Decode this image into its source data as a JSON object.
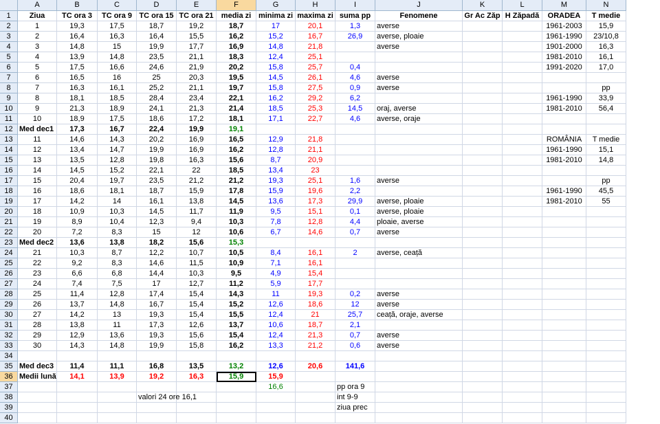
{
  "columns": [
    "A",
    "B",
    "C",
    "D",
    "E",
    "F",
    "G",
    "H",
    "I",
    "J",
    "K",
    "L",
    "M",
    "N"
  ],
  "selected_column": "F",
  "selected_row": "36",
  "header_row": [
    "Ziua",
    "TC ora 3",
    "TC ora 9",
    "TC ora 15",
    "TC ora 21",
    "media zi",
    "minima zi",
    "maxima zi",
    "suma pp",
    "Fenomene",
    "Gr Ac Zăp",
    "H Zăpadă",
    "ORADEA",
    "T medie"
  ],
  "rows": [
    {
      "r": "2",
      "v": [
        "1",
        "19,3",
        "17,5",
        "18,7",
        "19,2",
        "18,7",
        "17",
        "20,1",
        "1,3",
        "averse",
        "",
        "",
        "1961-2003",
        "15,9"
      ]
    },
    {
      "r": "3",
      "v": [
        "2",
        "16,4",
        "16,3",
        "16,4",
        "15,5",
        "16,2",
        "15,2",
        "16,7",
        "26,9",
        "averse, ploaie",
        "",
        "",
        "1961-1990",
        "23/10,8"
      ]
    },
    {
      "r": "4",
      "v": [
        "3",
        "14,8",
        "15",
        "19,9",
        "17,7",
        "16,9",
        "14,8",
        "21,8",
        "",
        "averse",
        "",
        "",
        "1901-2000",
        "16,3"
      ]
    },
    {
      "r": "5",
      "v": [
        "4",
        "13,9",
        "14,8",
        "23,5",
        "21,1",
        "18,3",
        "12,4",
        "25,1",
        "",
        "",
        "",
        "",
        "1981-2010",
        "16,1"
      ]
    },
    {
      "r": "6",
      "v": [
        "5",
        "17,5",
        "16,6",
        "24,6",
        "21,9",
        "20,2",
        "15,8",
        "25,7",
        "0,4",
        "",
        "",
        "",
        "1991-2020",
        "17,0"
      ]
    },
    {
      "r": "7",
      "v": [
        "6",
        "16,5",
        "16",
        "25",
        "20,3",
        "19,5",
        "14,5",
        "26,1",
        "4,6",
        "averse",
        "",
        "",
        "",
        ""
      ]
    },
    {
      "r": "8",
      "v": [
        "7",
        "16,3",
        "16,1",
        "25,2",
        "21,1",
        "19,7",
        "15,8",
        "27,5",
        "0,9",
        "averse",
        "",
        "",
        "",
        "pp"
      ]
    },
    {
      "r": "9",
      "v": [
        "8",
        "18,1",
        "18,5",
        "28,4",
        "23,4",
        "22,1",
        "16,2",
        "29,2",
        "6,2",
        "",
        "",
        "",
        "1961-1990",
        "33,9"
      ]
    },
    {
      "r": "10",
      "v": [
        "9",
        "21,3",
        "18,9",
        "24,1",
        "21,3",
        "21,4",
        "18,5",
        "25,3",
        "14,5",
        "oraj, averse",
        "",
        "",
        "1981-2010",
        "56,4"
      ]
    },
    {
      "r": "11",
      "v": [
        "10",
        "18,9",
        "17,5",
        "18,6",
        "17,2",
        "18,1",
        "17,1",
        "22,7",
        "4,6",
        "averse, oraje",
        "",
        "",
        "",
        ""
      ]
    },
    {
      "r": "12",
      "v": [
        "Med dec1",
        "17,3",
        "16,7",
        "22,4",
        "19,9",
        "19,1",
        "",
        "",
        "",
        "",
        "",
        "",
        "",
        ""
      ]
    },
    {
      "r": "13",
      "v": [
        "11",
        "14,6",
        "14,3",
        "20,2",
        "16,9",
        "16,5",
        "12,9",
        "21,8",
        "",
        "",
        "",
        "",
        "ROMÂNIA",
        "T medie"
      ]
    },
    {
      "r": "14",
      "v": [
        "12",
        "13,4",
        "14,7",
        "19,9",
        "16,9",
        "16,2",
        "12,8",
        "21,1",
        "",
        "",
        "",
        "",
        "1961-1990",
        "15,1"
      ]
    },
    {
      "r": "15",
      "v": [
        "13",
        "13,5",
        "12,8",
        "19,8",
        "16,3",
        "15,6",
        "8,7",
        "20,9",
        "",
        "",
        "",
        "",
        "1981-2010",
        "14,8"
      ]
    },
    {
      "r": "16",
      "v": [
        "14",
        "14,5",
        "15,2",
        "22,1",
        "22",
        "18,5",
        "13,4",
        "23",
        "",
        "",
        "",
        "",
        "",
        ""
      ]
    },
    {
      "r": "17",
      "v": [
        "15",
        "20,4",
        "19,7",
        "23,5",
        "21,2",
        "21,2",
        "19,3",
        "25,1",
        "1,6",
        "averse",
        "",
        "",
        "",
        "pp"
      ]
    },
    {
      "r": "18",
      "v": [
        "16",
        "18,6",
        "18,1",
        "18,7",
        "15,9",
        "17,8",
        "15,9",
        "19,6",
        "2,2",
        "",
        "",
        "",
        "1961-1990",
        "45,5"
      ]
    },
    {
      "r": "19",
      "v": [
        "17",
        "14,2",
        "14",
        "16,1",
        "13,8",
        "14,5",
        "13,6",
        "17,3",
        "29,9",
        "averse, ploaie",
        "",
        "",
        "1981-2010",
        "55"
      ]
    },
    {
      "r": "20",
      "v": [
        "18",
        "10,9",
        "10,3",
        "14,5",
        "11,7",
        "11,9",
        "9,5",
        "15,1",
        "0,1",
        "averse, ploaie",
        "",
        "",
        "",
        ""
      ]
    },
    {
      "r": "21",
      "v": [
        "19",
        "8,9",
        "10,4",
        "12,3",
        "9,4",
        "10,3",
        "7,8",
        "12,8",
        "4,4",
        "ploaie, averse",
        "",
        "",
        "",
        ""
      ]
    },
    {
      "r": "22",
      "v": [
        "20",
        "7,2",
        "8,3",
        "15",
        "12",
        "10,6",
        "6,7",
        "14,6",
        "0,7",
        "averse",
        "",
        "",
        "",
        ""
      ]
    },
    {
      "r": "23",
      "v": [
        "Med dec2",
        "13,6",
        "13,8",
        "18,2",
        "15,6",
        "15,3",
        "",
        "",
        "",
        "",
        "",
        "",
        "",
        ""
      ]
    },
    {
      "r": "24",
      "v": [
        "21",
        "10,3",
        "8,7",
        "12,2",
        "10,7",
        "10,5",
        "8,4",
        "16,1",
        "2",
        "averse, ceață",
        "",
        "",
        "",
        ""
      ]
    },
    {
      "r": "25",
      "v": [
        "22",
        "9,2",
        "8,3",
        "14,6",
        "11,5",
        "10,9",
        "7,1",
        "16,1",
        "",
        "",
        "",
        "",
        "",
        ""
      ]
    },
    {
      "r": "26",
      "v": [
        "23",
        "6,6",
        "6,8",
        "14,4",
        "10,3",
        "9,5",
        "4,9",
        "15,4",
        "",
        "",
        "",
        "",
        "",
        ""
      ]
    },
    {
      "r": "27",
      "v": [
        "24",
        "7,4",
        "7,5",
        "17",
        "12,7",
        "11,2",
        "5,9",
        "17,7",
        "",
        "",
        "",
        "",
        "",
        ""
      ]
    },
    {
      "r": "28",
      "v": [
        "25",
        "11,4",
        "12,8",
        "17,4",
        "15,4",
        "14,3",
        "11",
        "19,3",
        "0,2",
        "averse",
        "",
        "",
        "",
        ""
      ]
    },
    {
      "r": "29",
      "v": [
        "26",
        "13,7",
        "14,8",
        "16,7",
        "15,4",
        "15,2",
        "12,6",
        "18,6",
        "12",
        "averse",
        "",
        "",
        "",
        ""
      ]
    },
    {
      "r": "30",
      "v": [
        "27",
        "14,2",
        "13",
        "19,3",
        "15,4",
        "15,5",
        "12,4",
        "21",
        "25,7",
        "ceață, oraje, averse",
        "",
        "",
        "",
        ""
      ]
    },
    {
      "r": "31",
      "v": [
        "28",
        "13,8",
        "11",
        "17,3",
        "12,6",
        "13,7",
        "10,6",
        "18,7",
        "2,1",
        "",
        "",
        "",
        "",
        ""
      ]
    },
    {
      "r": "32",
      "v": [
        "29",
        "12,9",
        "13,6",
        "19,3",
        "15,6",
        "15,4",
        "12,4",
        "21,3",
        "0,7",
        "averse",
        "",
        "",
        "",
        ""
      ]
    },
    {
      "r": "33",
      "v": [
        "30",
        "14,3",
        "14,8",
        "19,9",
        "15,8",
        "16,2",
        "13,3",
        "21,2",
        "0,6",
        "averse",
        "",
        "",
        "",
        ""
      ]
    },
    {
      "r": "34",
      "v": [
        "",
        "",
        "",
        "",
        "",
        "",
        "",
        "",
        "",
        "",
        "",
        "",
        "",
        ""
      ]
    },
    {
      "r": "35",
      "v": [
        "Med dec3",
        "11,4",
        "11,1",
        "16,8",
        "13,5",
        "13,2",
        "12,6",
        "20,6",
        "141,6",
        "",
        "",
        "",
        "",
        ""
      ]
    },
    {
      "r": "36",
      "v": [
        "Medii lună",
        "14,1",
        "13,9",
        "19,2",
        "16,3",
        "15,9",
        "15,9",
        "",
        "",
        "",
        "",
        "",
        "",
        ""
      ]
    },
    {
      "r": "37",
      "v": [
        "",
        "",
        "",
        "",
        "",
        "",
        "16,6",
        "",
        "pp ora 9",
        "",
        "",
        "",
        "",
        ""
      ]
    },
    {
      "r": "38",
      "v": [
        "",
        "",
        "",
        "valori 24 ore 16,1",
        "",
        "",
        "",
        "",
        "int 9-9",
        "",
        "",
        "",
        "",
        ""
      ]
    },
    {
      "r": "39",
      "v": [
        "",
        "",
        "",
        "",
        "",
        "",
        "",
        "",
        "ziua prec",
        "",
        "",
        "",
        "",
        ""
      ]
    },
    {
      "r": "40",
      "v": [
        "",
        "",
        "",
        "",
        "",
        "",
        "",
        "",
        "",
        "",
        "",
        "",
        "",
        ""
      ]
    }
  ],
  "colors": {
    "blue": "#0000ff",
    "red": "#ff0000",
    "green": "#008000",
    "header_bg": "#e4ecf7",
    "selected_header": "#f9d99f"
  }
}
